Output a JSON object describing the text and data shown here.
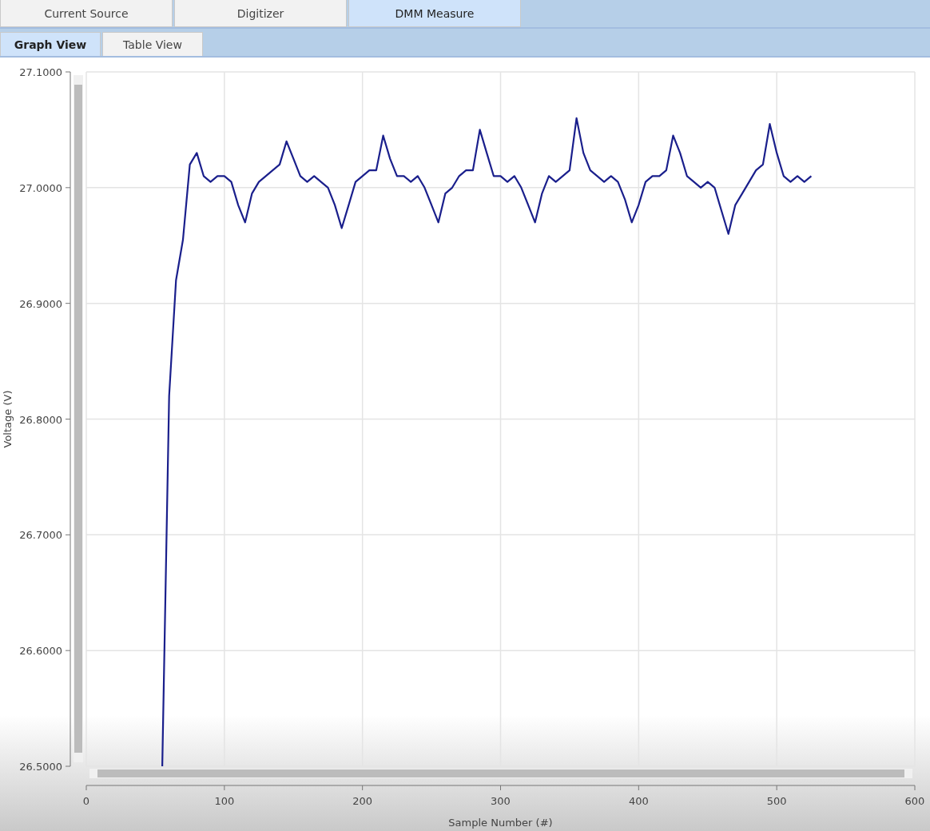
{
  "tabs": [
    {
      "label": "Current Source",
      "selected": false
    },
    {
      "label": "Digitizer",
      "selected": false
    },
    {
      "label": "DMM Measure",
      "selected": true
    }
  ],
  "view_tabs": [
    {
      "label": "Graph View",
      "selected": true
    },
    {
      "label": "Table View",
      "selected": false
    }
  ],
  "chart": {
    "chart_data": {
      "type": "line",
      "xlabel": "Sample Number (#)",
      "ylabel": "Voltage (V)",
      "x": [
        55,
        60,
        65,
        70,
        75,
        80,
        85,
        90,
        95,
        100,
        105,
        110,
        115,
        120,
        125,
        130,
        135,
        140,
        145,
        150,
        155,
        160,
        165,
        170,
        175,
        180,
        185,
        190,
        195,
        200,
        205,
        210,
        215,
        220,
        225,
        230,
        235,
        240,
        245,
        250,
        255,
        260,
        265,
        270,
        275,
        280,
        285,
        290,
        295,
        300,
        305,
        310,
        315,
        320,
        325,
        330,
        335,
        340,
        345,
        350,
        355,
        360,
        365,
        370,
        375,
        380,
        385,
        390,
        395,
        400,
        405,
        410,
        415,
        420,
        425,
        430,
        435,
        440,
        445,
        450,
        455,
        460,
        465,
        470,
        475,
        480,
        485,
        490,
        495,
        500,
        505,
        510,
        515,
        520,
        525
      ],
      "series": [
        {
          "color": "#1a1f8c",
          "values": [
            26.5,
            26.82,
            26.92,
            26.955,
            27.02,
            27.03,
            27.01,
            27.005,
            27.01,
            27.01,
            27.005,
            26.985,
            26.97,
            26.995,
            27.005,
            27.01,
            27.015,
            27.02,
            27.04,
            27.025,
            27.01,
            27.005,
            27.01,
            27.005,
            27.0,
            26.985,
            26.965,
            26.985,
            27.005,
            27.01,
            27.015,
            27.015,
            27.045,
            27.025,
            27.01,
            27.01,
            27.005,
            27.01,
            27.0,
            26.985,
            26.97,
            26.995,
            27.0,
            27.01,
            27.015,
            27.015,
            27.05,
            27.03,
            27.01,
            27.01,
            27.005,
            27.01,
            27.0,
            26.985,
            26.97,
            26.995,
            27.01,
            27.005,
            27.01,
            27.015,
            27.06,
            27.03,
            27.015,
            27.01,
            27.005,
            27.01,
            27.005,
            26.99,
            26.97,
            26.985,
            27.005,
            27.01,
            27.01,
            27.015,
            27.045,
            27.03,
            27.01,
            27.005,
            27.0,
            27.005,
            27.0,
            26.98,
            26.96,
            26.985,
            26.995,
            27.005,
            27.015,
            27.02,
            27.055,
            27.03,
            27.01,
            27.005,
            27.01,
            27.005,
            27.01
          ]
        }
      ],
      "grid": true,
      "xlim": [
        0,
        600
      ],
      "ylim": [
        26.5,
        27.1
      ],
      "xticks": [
        0,
        100,
        200,
        300,
        400,
        500,
        600
      ],
      "yticks": [
        {
          "value": 26.5,
          "label": "26.5000"
        },
        {
          "value": 26.6,
          "label": "26.6000"
        },
        {
          "value": 26.7,
          "label": "26.7000"
        },
        {
          "value": 26.8,
          "label": "26.8000"
        },
        {
          "value": 26.9,
          "label": "26.9000"
        },
        {
          "value": 27.0,
          "label": "27.0000"
        },
        {
          "value": 27.1,
          "label": "27.1000"
        }
      ]
    }
  }
}
